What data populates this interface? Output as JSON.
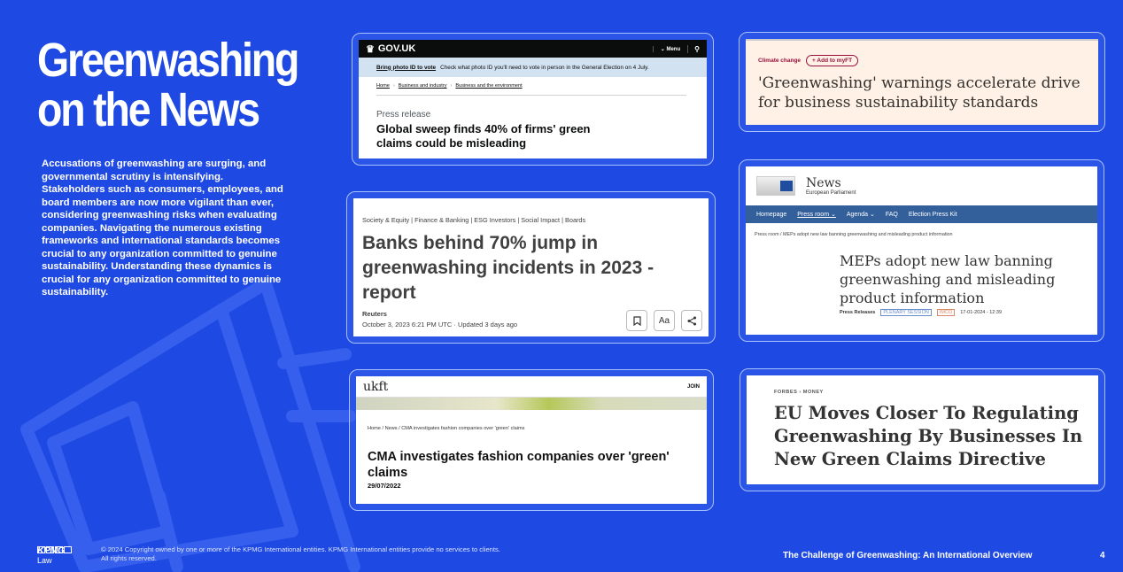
{
  "slide": {
    "title_line1": "Greenwashing",
    "title_line2": "on the News",
    "intro": "Accusations of greenwashing are surging, and governmental scrutiny is intensifying. Stakeholders such as consumers, employees, and board members are now more vigilant than ever, considering greenwashing risks when evaluating companies. Navigating the numerous existing frameworks and international standards becomes crucial to any organization committed to genuine sustainability. Understanding these dynamics is crucial for any organization committed to genuine sustainability."
  },
  "gov": {
    "brand": "GOV.UK",
    "menu": "Menu",
    "banner_link": "Bring photo ID to vote",
    "banner_text": "Check what photo ID you'll need to vote in person in the General Election on 4 July.",
    "crumbs": [
      "Home",
      "Business and industry",
      "Business and the environment"
    ],
    "kicker": "Press release",
    "headline": "Global sweep finds 40% of firms' green claims could be misleading"
  },
  "reuters": {
    "tags": "Society & Equity | Finance & Banking | ESG Investors | Social Impact | Boards",
    "headline": "Banks behind 70% jump in greenwashing incidents in 2023 - report",
    "source": "Reuters",
    "date": "October 3, 2023 6:21 PM UTC · Updated 3 days ago",
    "text_size_label": "Aa"
  },
  "ukft": {
    "logo": "ukft",
    "join": "JOIN",
    "crumbs": "Home / News / CMA investigates fashion companies over 'green' claims",
    "headline": "CMA investigates fashion companies over 'green' claims",
    "date": "29/07/2022"
  },
  "ft": {
    "topic": "Climate change",
    "add": "+ Add to myFT",
    "headline": "'Greenwashing' warnings accelerate drive for business sustainability standards"
  },
  "ep": {
    "name": "News",
    "sub": "European Parliament",
    "nav": [
      "Homepage",
      "Press room ⌄",
      "Agenda ⌄",
      "FAQ",
      "Election Press Kit"
    ],
    "crumbs": "Press room / MEPs adopt new law banning greenwashing and misleading product information",
    "headline": "MEPs adopt new law banning greenwashing and misleading product information",
    "meta_type": "Press Releases",
    "meta_badge1": "PLENARY SESSION",
    "meta_badge2": "IMCO",
    "meta_date": "17-01-2024 - 12:39"
  },
  "forbes": {
    "kicker": "FORBES › MONEY",
    "headline": "EU Moves Closer To Regulating Greenwashing By Businesses In New Green Claims Directive"
  },
  "footer": {
    "logo": "KPMG",
    "logo_sub": "Law",
    "copyright_line1": "© 2024 Copyright owned by one or more of the KPMG International entities. KPMG International entities provide no services to clients.",
    "copyright_line2": "All rights reserved.",
    "title": "The Challenge of Greenwashing: An International Overview",
    "page": "4"
  },
  "colors": {
    "background": "#1e49e2",
    "card_border": "#a9c0ff",
    "ft_bg": "#fff1e5",
    "ep_nav": "#33609b"
  },
  "icons": [
    "crown-icon",
    "search-icon",
    "bookmark-icon",
    "share-icon",
    "megaphone-icon"
  ]
}
